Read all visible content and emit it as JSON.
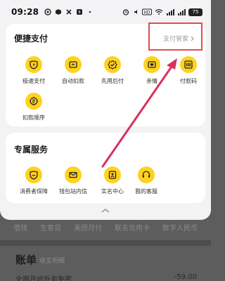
{
  "status_bar": {
    "time": "09:28",
    "battery": "75"
  },
  "quick_pay": {
    "title": "便捷支付",
    "manage_label": "支付管家",
    "items": [
      {
        "label": "极速支付",
        "icon": "lightning-icon"
      },
      {
        "label": "自动扣款",
        "icon": "auto-deduct-icon"
      },
      {
        "label": "先用后付",
        "icon": "badge-check-icon"
      },
      {
        "label": "亲情",
        "icon": "family-card-icon"
      },
      {
        "label": "付款码",
        "icon": "barcode-icon"
      },
      {
        "label": "扣款顺序",
        "icon": "sort-order-icon"
      }
    ]
  },
  "services": {
    "title": "专属服务",
    "items": [
      {
        "label": "消费者保障",
        "icon": "shield-icon"
      },
      {
        "label": "钱包站内信",
        "icon": "mail-icon"
      },
      {
        "label": "实名中心",
        "icon": "id-card-icon"
      },
      {
        "label": "我的客服",
        "icon": "headset-icon"
      }
    ]
  },
  "background": {
    "strip_items": [
      "借钱",
      "生意贷",
      "美团月付",
      "联名信用卡",
      "数字人民币"
    ],
    "bill_title": "账单",
    "bill_subtitle": "收支明细",
    "row_left": "全面开启外卖免密",
    "row_right": "-59.00"
  },
  "colors": {
    "accent_yellow": "#ffd21f",
    "annotation_red": "#e8494d",
    "arrow": "#d8315b"
  }
}
